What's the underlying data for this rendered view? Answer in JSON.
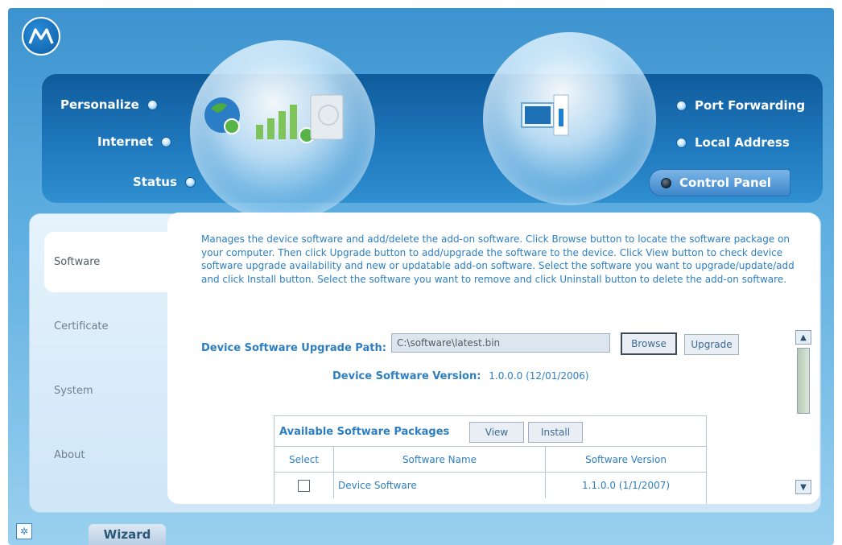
{
  "brand": {
    "logo_icon": "motorola-logo-icon",
    "accent": "#2d7fc1"
  },
  "nav": {
    "personalize": "Personalize",
    "internet": "Internet",
    "status": "Status",
    "port_forwarding": "Port Forwarding",
    "local_address": "Local Address",
    "control_panel": "Control Panel"
  },
  "tabs": {
    "software": "Software",
    "certificate": "Certificate",
    "system": "System",
    "about": "About"
  },
  "content": {
    "description": "Manages the device software and add/delete the add-on software. Click Browse button to locate the software package on your computer. Then click Upgrade button to add/upgrade the software to the device. Click View button to check device software upgrade availability and new or updatable add-on software. Select the software you want to upgrade/update/add and click Install button. Select the software you want to remove and click Uninstall button to delete the add-on software.",
    "upgrade_path_label": "Device Software Upgrade Path:",
    "upgrade_path_value": "C:\\software\\latest.bin",
    "browse_label": "Browse",
    "upgrade_label": "Upgrade",
    "version_label": "Device Software Version:",
    "version_value": "1.0.0.0 (12/01/2006)"
  },
  "packages": {
    "title": "Available Software Packages",
    "view_label": "View",
    "install_label": "Install",
    "columns": [
      "Select",
      "Software Name",
      "Software Version"
    ],
    "rows": [
      {
        "name": "Device Software",
        "version": "1.1.0.0 (1/1/2007)"
      }
    ]
  },
  "footer": {
    "wizard_label": "Wizard"
  }
}
